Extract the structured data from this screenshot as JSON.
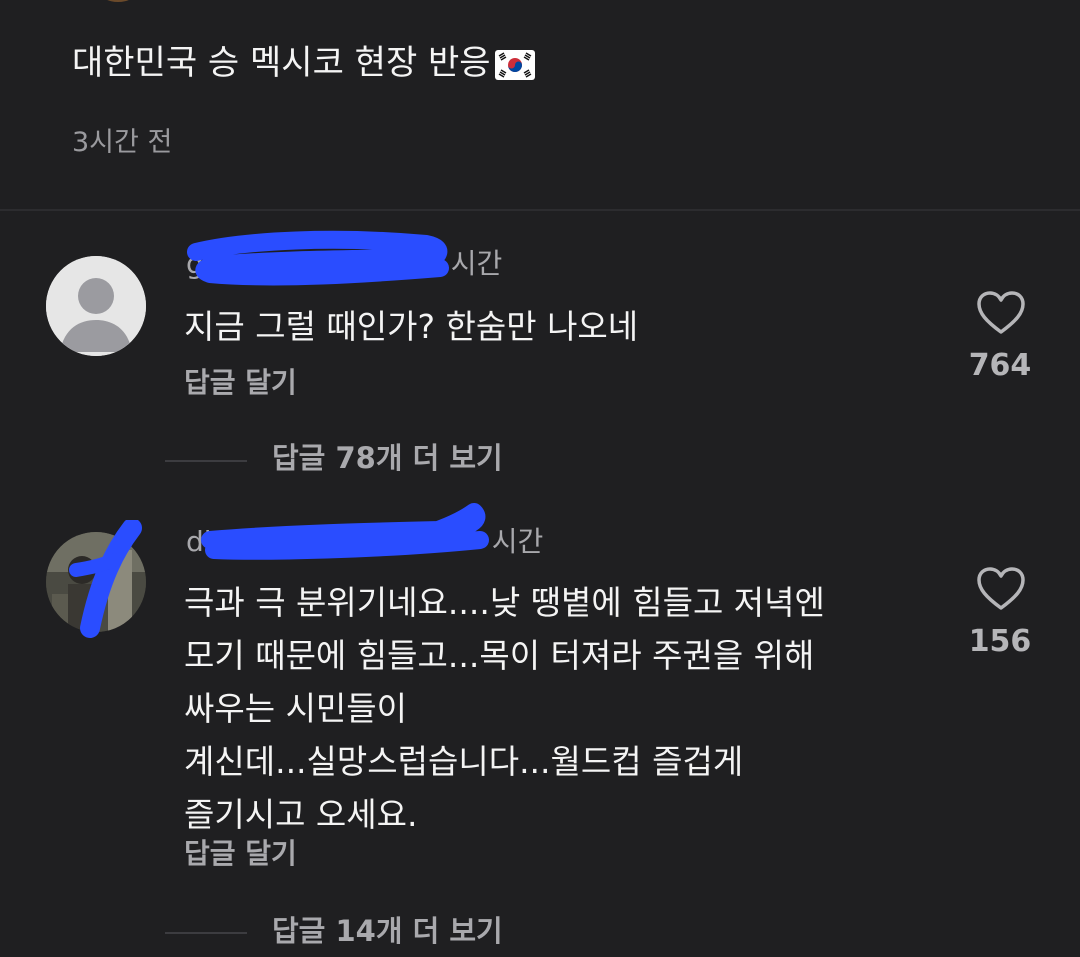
{
  "post": {
    "caption": "대한민국 승 멕시코 현장 반응",
    "flag_icon": "south-korea-flag-icon",
    "time": "3시간 전"
  },
  "comments": [
    {
      "username_visible": "g",
      "time_suffix": "시간",
      "avatar": "default-user-avatar",
      "text": "지금 그럴 때인가? 한숨만 나오네",
      "reply_label": "답글 달기",
      "likes": "764",
      "view_replies": "답글 78개 더 보기"
    },
    {
      "username_visible": "dia",
      "time_suffix": "시간",
      "avatar": "photo-avatar",
      "text_lines": [
        "극과 극 분위기네요....낮 땡볕에 힘들고 저녁엔",
        "모기 때문에 힘들고...목이 터져라 주권을 위해",
        "싸우는 시민들이",
        "계신데...실망스럽습니다...월드컵 즐겁게",
        "즐기시고 오세요."
      ],
      "reply_label": "답글 달기",
      "likes": "156",
      "view_replies": "답글 14개 더 보기"
    }
  ],
  "colors": {
    "background": "#1f1f21",
    "redaction": "#2a4dff",
    "text_primary": "#f4f4f4",
    "text_secondary": "#a9a9ad"
  },
  "icons": [
    "heart-icon",
    "south-korea-flag-icon"
  ]
}
